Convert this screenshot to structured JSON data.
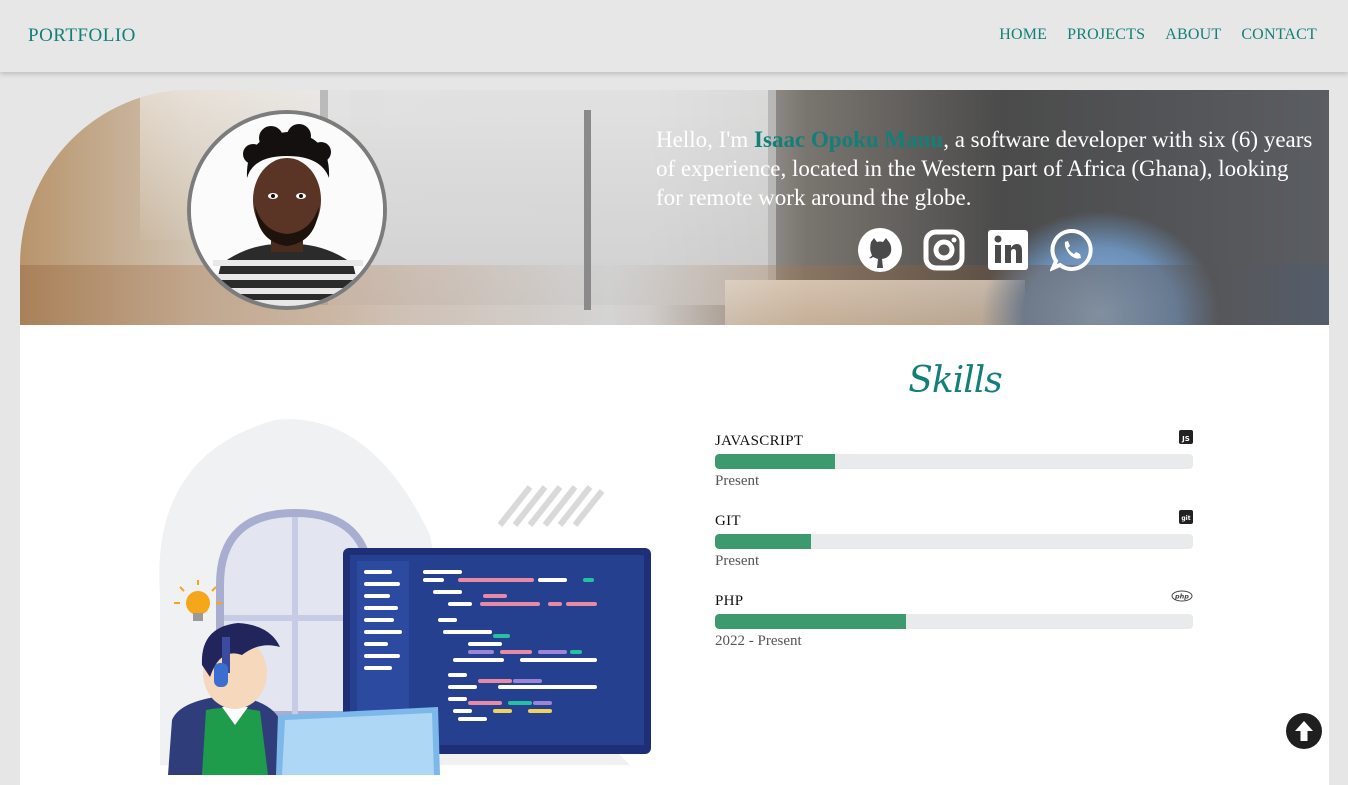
{
  "nav": {
    "brand": "PORTFOLIO",
    "links": [
      "HOME",
      "PROJECTS",
      "ABOUT",
      "CONTACT"
    ]
  },
  "hero": {
    "intro_prefix": "Hello, I'm ",
    "name": "Isaac Opoku Manu",
    "intro_suffix": ", a software developer with six (6) years of experience, located in the Western part of Africa (Ghana), looking for remote work around the globe.",
    "socials": [
      "github-icon",
      "instagram-icon",
      "linkedin-icon",
      "whatsapp-icon"
    ]
  },
  "skills": {
    "title": "Skills",
    "items": [
      {
        "name": "JAVASCRIPT",
        "icon": "js-icon",
        "level": 0.25,
        "period": "Present"
      },
      {
        "name": "GIT",
        "icon": "git-icon",
        "level": 0.2,
        "period": "Present"
      },
      {
        "name": "PHP",
        "icon": "php-icon",
        "level": 0.4,
        "period": "2022 - Present"
      }
    ]
  },
  "colors": {
    "accent": "#128078",
    "bar_fill": "#3d9a6e",
    "bar_track": "#e8eaec",
    "page_bg": "#e6e6e6"
  }
}
